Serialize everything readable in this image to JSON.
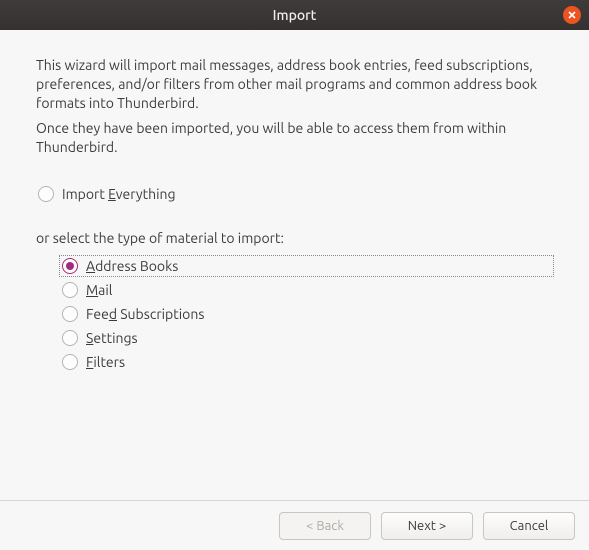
{
  "window": {
    "title": "Import"
  },
  "intro": {
    "p1": "This wizard will import mail messages, address book entries, feed subscriptions, preferences, and/or filters from other mail programs and common address book formats into Thunderbird.",
    "p2": "Once they have been imported, you will be able to access them from within Thunderbird."
  },
  "options": {
    "everything": {
      "pre": "Import ",
      "accel": "E",
      "post": "verything",
      "selected": false
    },
    "subhead": "or select the type of material to import:",
    "list": [
      {
        "id": "address-books",
        "pre": "",
        "accel": "A",
        "post": "ddress Books",
        "selected": true
      },
      {
        "id": "mail",
        "pre": "",
        "accel": "M",
        "post": "ail",
        "selected": false
      },
      {
        "id": "feed-subs",
        "pre": "Fee",
        "accel": "d",
        "post": " Subscriptions",
        "selected": false
      },
      {
        "id": "settings",
        "pre": "",
        "accel": "S",
        "post": "ettings",
        "selected": false
      },
      {
        "id": "filters",
        "pre": "",
        "accel": "F",
        "post": "ilters",
        "selected": false
      }
    ]
  },
  "buttons": {
    "back": "< Back",
    "next": "Next >",
    "cancel": "Cancel"
  }
}
